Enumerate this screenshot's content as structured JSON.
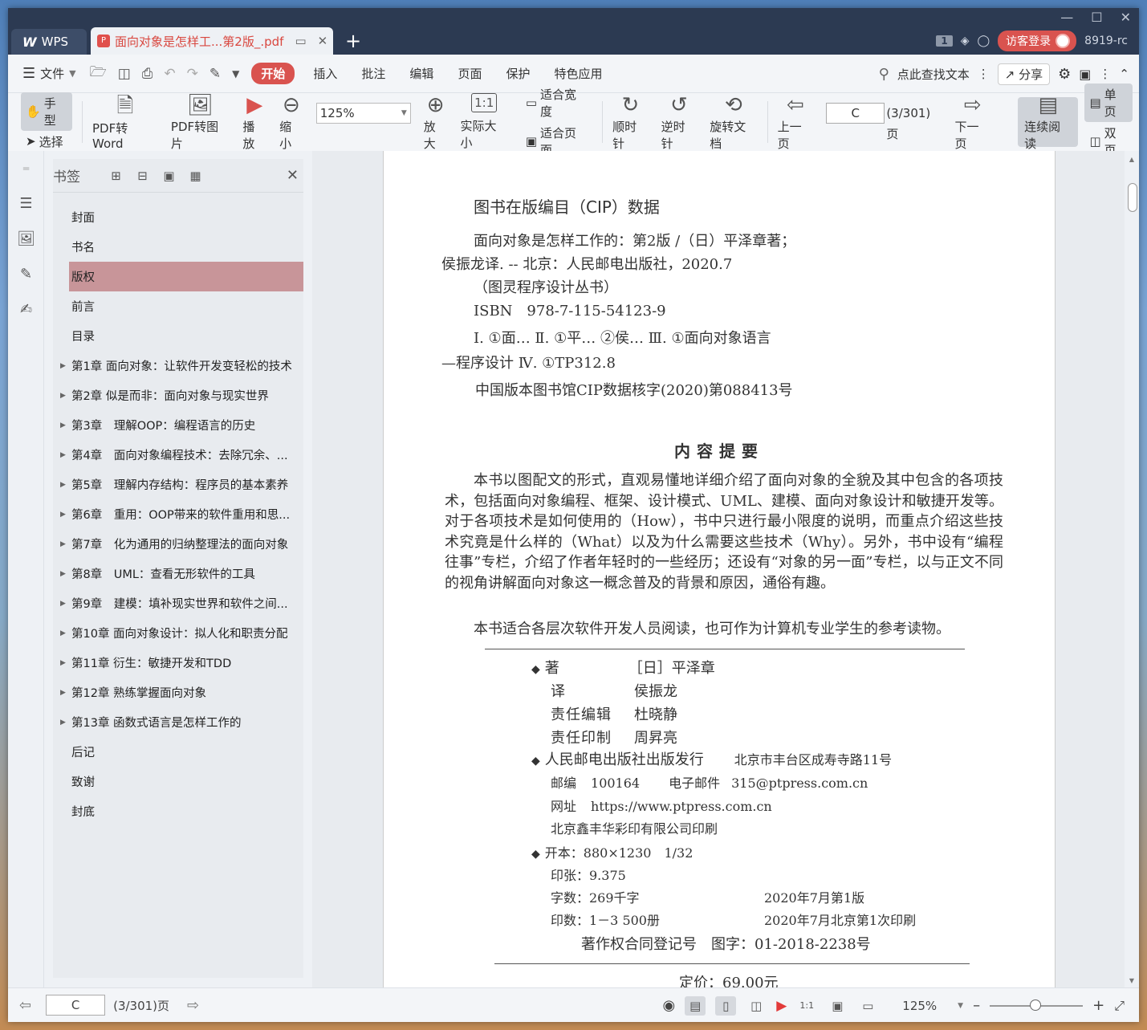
{
  "titlebar": {
    "wps_label": "WPS",
    "doc_tab_title": "面向对象是怎样工...第2版_.pdf",
    "new_tab": "+",
    "count": "1",
    "guest_login": "访客登录",
    "user_id": "8919-rc"
  },
  "menubar": {
    "file": "文件",
    "tabs": [
      "开始",
      "插入",
      "批注",
      "编辑",
      "页面",
      "保护",
      "特色应用"
    ],
    "search": "点此查找文本",
    "share": "分享"
  },
  "toolbar": {
    "hand": "手型",
    "select": "选择",
    "pdf_to_word": "PDF转Word",
    "pdf_to_image": "PDF转图片",
    "play": "播放",
    "zoom_out": "缩小",
    "zoom_value": "125%",
    "zoom_in": "放大",
    "actual_size": "实际大小",
    "fit_width": "适合宽度",
    "fit_page": "适合页面",
    "clockwise": "顺时针",
    "counter_clockwise": "逆时针",
    "rotate_doc": "旋转文档",
    "prev_page": "上一页",
    "page_value": "C",
    "page_total": "(3/301)页",
    "next_page": "下一页",
    "continuous": "连续阅读",
    "single": "单页",
    "double": "双页"
  },
  "bookmarks": {
    "title": "书签",
    "items": [
      {
        "label": "封面",
        "expandable": false,
        "selected": false
      },
      {
        "label": "书名",
        "expandable": false,
        "selected": false
      },
      {
        "label": "版权",
        "expandable": false,
        "selected": true
      },
      {
        "label": "前言",
        "expandable": false,
        "selected": false
      },
      {
        "label": "目录",
        "expandable": false,
        "selected": false
      },
      {
        "label": "第1章 面向对象：让软件开发变轻松的技术",
        "expandable": true,
        "selected": false
      },
      {
        "label": "第2章 似是而非：面向对象与现实世界",
        "expandable": true,
        "selected": false
      },
      {
        "label": "第3章　理解OOP：编程语言的历史",
        "expandable": true,
        "selected": false
      },
      {
        "label": "第4章　面向对象编程技术：去除冗余、...",
        "expandable": true,
        "selected": false
      },
      {
        "label": "第5章　理解内存结构：程序员的基本素养",
        "expandable": true,
        "selected": false
      },
      {
        "label": "第6章　重用：OOP带来的软件重用和思...",
        "expandable": true,
        "selected": false
      },
      {
        "label": "第7章　化为通用的归纳整理法的面向对象",
        "expandable": true,
        "selected": false
      },
      {
        "label": "第8章　UML：查看无形软件的工具",
        "expandable": true,
        "selected": false
      },
      {
        "label": "第9章　建模：填补现实世界和软件之间...",
        "expandable": true,
        "selected": false
      },
      {
        "label": "第10章 面向对象设计：拟人化和职责分配",
        "expandable": true,
        "selected": false
      },
      {
        "label": "第11章 衍生：敏捷开发和TDD",
        "expandable": true,
        "selected": false
      },
      {
        "label": "第12章 熟练掌握面向对象",
        "expandable": true,
        "selected": false
      },
      {
        "label": "第13章 函数式语言是怎样工作的",
        "expandable": true,
        "selected": false
      },
      {
        "label": "后记",
        "expandable": false,
        "selected": false
      },
      {
        "label": "致谢",
        "expandable": false,
        "selected": false
      },
      {
        "label": "封底",
        "expandable": false,
        "selected": false
      }
    ]
  },
  "page": {
    "cip_title": "图书在版编目（CIP）数据",
    "cip_line1": "面向对象是怎样工作的：第2版 /（日）平泽章著；",
    "cip_line2": "侯振龙译. -- 北京：人民邮电出版社，2020.7",
    "cip_line3": "（图灵程序设计丛书）",
    "cip_line4": "ISBN　978-7-115-54123-9",
    "cip_line5": "Ⅰ. ①面… Ⅱ. ①平… ②侯… Ⅲ. ①面向对象语言",
    "cip_line6": "—程序设计 Ⅳ. ①TP312.8",
    "cip_line7": "中国版本图书馆CIP数据核字(2020)第088413号",
    "summary_title": "内容提要",
    "summary_p1": "本书以图配文的形式，直观易懂地详细介绍了面向对象的全貌及其中包含的各项技术，包括面向对象编程、框架、设计模式、UML、建模、面向对象设计和敏捷开发等。对于各项技术是如何使用的（How），书中只进行最小限度的说明，而重点介绍这些技术究竟是什么样的（What）以及为什么需要这些技术（Why）。另外，书中设有“编程往事”专栏，介绍了作者年轻时的一些经历；还设有“对象的另一面”专栏，以与正文不同的视角讲解面向对象这一概念普及的背景和原因，通俗有趣。",
    "summary_p2": "本书适合各层次软件开发人员阅读，也可作为计算机专业学生的参考读物。",
    "author_label": "著",
    "author": "［日］平泽章",
    "translator_label": "译",
    "translator": "侯振龙",
    "editor_label": "责任编辑",
    "editor": "杜晓静",
    "printer_label": "责任印制",
    "printer": "周昇亮",
    "publisher": "人民邮电出版社出版发行",
    "address": "北京市丰台区成寿寺路11号",
    "postcode_label": "邮编",
    "postcode": "100164",
    "email_label": "电子邮件",
    "email": "315@ptpress.com.cn",
    "website_label": "网址",
    "website": "https://www.ptpress.com.cn",
    "print_company": "北京鑫丰华彩印有限公司印刷",
    "format": "开本：880×1230　1/32",
    "sheets": "印张：9.375",
    "words": "字数：269千字",
    "edition": "2020年7月第1版",
    "print_count": "印数：1－3 500册",
    "print_date": "2020年7月北京第1次印刷",
    "copyright_reg": "著作权合同登记号　图字：01-2018-2238号",
    "price": "定价：69.00元"
  },
  "statusbar": {
    "page_value": "C",
    "page_total": "(3/301)页",
    "zoom": "125%"
  }
}
